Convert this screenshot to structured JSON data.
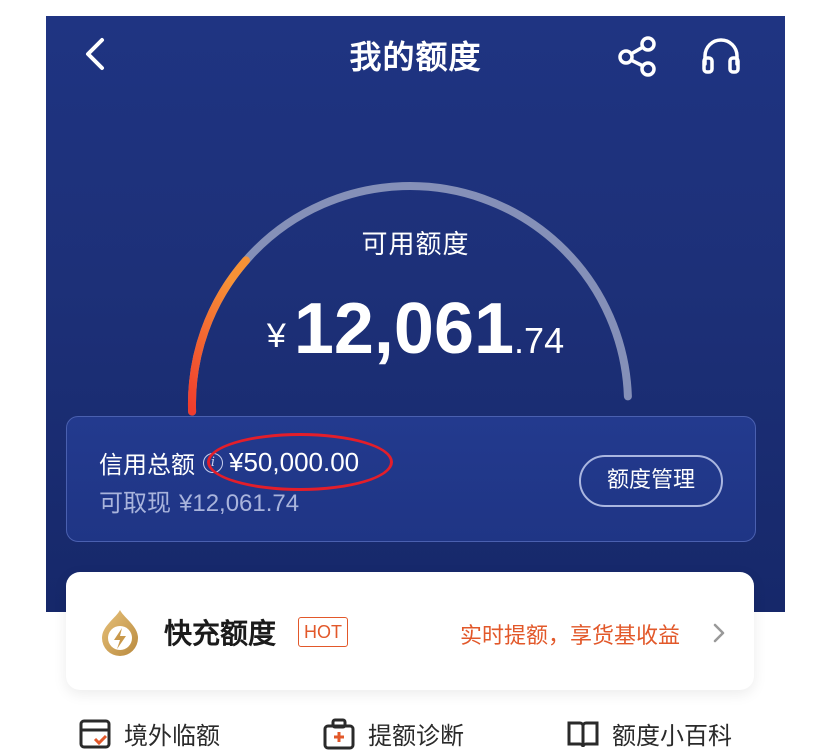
{
  "header": {
    "title": "我的额度",
    "back_icon": "chevron-left-icon",
    "share_icon": "share-icon",
    "service_icon": "headset-icon"
  },
  "gauge": {
    "label": "可用额度",
    "currency": "¥",
    "amount_int": "12,061",
    "amount_dec": ".74",
    "used_fraction": 0.24
  },
  "credit": {
    "total_label": "信用总额",
    "total_value": "¥50,000.00",
    "cash_label": "可取现",
    "cash_value": "¥12,061.74",
    "manage_label": "额度管理"
  },
  "quick": {
    "title": "快充额度",
    "badge": "HOT",
    "promo": "实时提额，享货基收益"
  },
  "bottom": {
    "items": [
      {
        "label": "境外临额",
        "icon": "card-icon"
      },
      {
        "label": "提额诊断",
        "icon": "medical-kit-icon"
      },
      {
        "label": "额度小百科",
        "icon": "book-icon"
      }
    ]
  },
  "colors": {
    "hero_bg": "#1f3482",
    "gauge_track": "#8590b8",
    "gauge_fill_start": "#ef3c2d",
    "gauge_fill_end": "#f79236",
    "accent_orange": "#e2582a",
    "highlight_red": "#e31e2a"
  }
}
